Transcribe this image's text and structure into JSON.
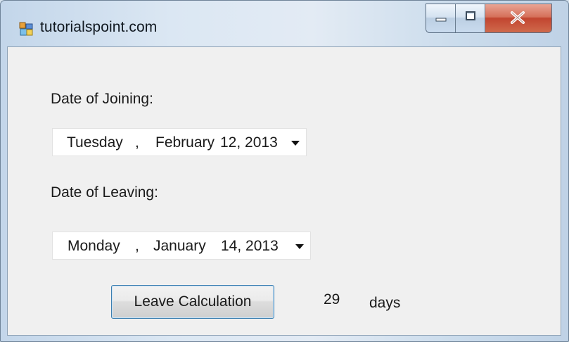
{
  "window": {
    "title": "tutorialspoint.com",
    "caption_buttons": [
      "minimize-icon",
      "maximize-icon",
      "close-icon"
    ]
  },
  "form": {
    "joining_label": "Date of Joining:",
    "joining_date": {
      "day_of_week": "Tuesday",
      "sep": ",",
      "month": "February",
      "day_year": "12, 2013"
    },
    "leaving_label": "Date of Leaving:",
    "leaving_date": {
      "day_of_week": "Monday",
      "sep": ",",
      "month": "January",
      "day_year": "14, 2013"
    },
    "calc_button_label": "Leave Calculation",
    "result_value": "29",
    "result_unit": "days"
  },
  "colors": {
    "close_button": "#c24530",
    "button_border": "#3c7fb1",
    "client_bg": "#f0f0f0"
  }
}
